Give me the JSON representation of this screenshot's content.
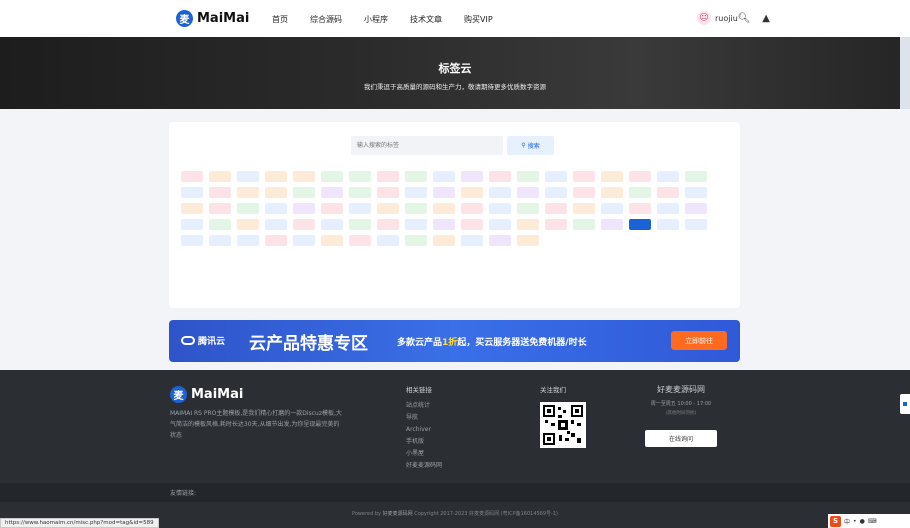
{
  "header": {
    "logo_mark": "麦",
    "logo_text": "MaiMai",
    "nav": [
      "首页",
      "综合源码",
      "小程序",
      "技术文章",
      "购买VIP"
    ],
    "user_name": "ruojiu"
  },
  "hero": {
    "title": "标签云",
    "subtitle": "我们秉逗于高质量的源码和生产力，敬请期待更多优质数字资源"
  },
  "search": {
    "placeholder": "输入搜索的标签",
    "button_label": "搜索"
  },
  "tags": [
    {
      "label": "",
      "bg": "#fde2e7",
      "fg": "#e8467c"
    },
    {
      "label": "",
      "bg": "#fdebd7",
      "fg": "#ef8a1f"
    },
    {
      "label": "",
      "bg": "#e5efff",
      "fg": "#2e6fe0"
    },
    {
      "label": "",
      "bg": "#fdebd7",
      "fg": "#ef8a1f"
    },
    {
      "label": "",
      "bg": "#fdebd7",
      "fg": "#ef8a1f"
    },
    {
      "label": "",
      "bg": "#e3f6e6",
      "fg": "#2fa84b"
    },
    {
      "label": "",
      "bg": "#e3f6e6",
      "fg": "#2fa84b"
    },
    {
      "label": "",
      "bg": "#fde2e7",
      "fg": "#e8467c"
    },
    {
      "label": "",
      "bg": "#e3f6e6",
      "fg": "#2fa84b"
    },
    {
      "label": "",
      "bg": "#e5efff",
      "fg": "#2e6fe0"
    },
    {
      "label": "",
      "bg": "#efe5fd",
      "fg": "#8a4fe0"
    },
    {
      "label": "",
      "bg": "#fde2e7",
      "fg": "#e8467c"
    },
    {
      "label": "",
      "bg": "#e3f6e6",
      "fg": "#2fa84b"
    },
    {
      "label": "",
      "bg": "#e5efff",
      "fg": "#2e6fe0"
    },
    {
      "label": "",
      "bg": "#fde2e7",
      "fg": "#e8467c"
    },
    {
      "label": "",
      "bg": "#fdebd7",
      "fg": "#ef8a1f"
    },
    {
      "label": "",
      "bg": "#fde2e7",
      "fg": "#e8467c"
    },
    {
      "label": "",
      "bg": "#e5efff",
      "fg": "#2e6fe0"
    },
    {
      "label": "",
      "bg": "#e3f6e6",
      "fg": "#2fa84b"
    },
    {
      "label": "",
      "bg": "#e5efff",
      "fg": "#2e6fe0"
    },
    {
      "label": "",
      "bg": "#fde2e7",
      "fg": "#e8467c"
    },
    {
      "label": "",
      "bg": "#fdebd7",
      "fg": "#ef8a1f"
    },
    {
      "label": "",
      "bg": "#fdebd7",
      "fg": "#ef8a1f"
    },
    {
      "label": "",
      "bg": "#e3f6e6",
      "fg": "#2fa84b"
    },
    {
      "label": "",
      "bg": "#efe5fd",
      "fg": "#8a4fe0"
    },
    {
      "label": "",
      "bg": "#e3f6e6",
      "fg": "#2fa84b"
    },
    {
      "label": "",
      "bg": "#fde2e7",
      "fg": "#e8467c"
    },
    {
      "label": "",
      "bg": "#e5efff",
      "fg": "#2e6fe0"
    },
    {
      "label": "",
      "bg": "#efe5fd",
      "fg": "#8a4fe0"
    },
    {
      "label": "",
      "bg": "#fdebd7",
      "fg": "#ef8a1f"
    },
    {
      "label": "",
      "bg": "#e5efff",
      "fg": "#2e6fe0"
    },
    {
      "label": "",
      "bg": "#efe5fd",
      "fg": "#8a4fe0"
    },
    {
      "label": "",
      "bg": "#e5efff",
      "fg": "#2e6fe0"
    },
    {
      "label": "",
      "bg": "#fde2e7",
      "fg": "#e8467c"
    },
    {
      "label": "",
      "bg": "#fdebd7",
      "fg": "#ef8a1f"
    },
    {
      "label": "",
      "bg": "#e3f6e6",
      "fg": "#2fa84b"
    },
    {
      "label": "",
      "bg": "#fde2e7",
      "fg": "#e8467c"
    },
    {
      "label": "",
      "bg": "#e5efff",
      "fg": "#2e6fe0"
    },
    {
      "label": "",
      "bg": "#fdebd7",
      "fg": "#ef8a1f"
    },
    {
      "label": "",
      "bg": "#fde2e7",
      "fg": "#e8467c"
    },
    {
      "label": "",
      "bg": "#e3f6e6",
      "fg": "#2fa84b"
    },
    {
      "label": "",
      "bg": "#e5efff",
      "fg": "#2e6fe0"
    },
    {
      "label": "",
      "bg": "#efe5fd",
      "fg": "#8a4fe0"
    },
    {
      "label": "",
      "bg": "#fde2e7",
      "fg": "#e8467c"
    },
    {
      "label": "",
      "bg": "#e5efff",
      "fg": "#2e6fe0"
    },
    {
      "label": "",
      "bg": "#fdebd7",
      "fg": "#ef8a1f"
    },
    {
      "label": "",
      "bg": "#e3f6e6",
      "fg": "#2fa84b"
    },
    {
      "label": "",
      "bg": "#fdebd7",
      "fg": "#ef8a1f"
    },
    {
      "label": "",
      "bg": "#fde2e7",
      "fg": "#e8467c"
    },
    {
      "label": "",
      "bg": "#e5efff",
      "fg": "#2e6fe0"
    },
    {
      "label": "",
      "bg": "#e3f6e6",
      "fg": "#2fa84b"
    },
    {
      "label": "",
      "bg": "#fde2e7",
      "fg": "#e8467c"
    },
    {
      "label": "",
      "bg": "#fdebd7",
      "fg": "#ef8a1f"
    },
    {
      "label": "",
      "bg": "#e5efff",
      "fg": "#2e6fe0"
    },
    {
      "label": "",
      "bg": "#fde2e7",
      "fg": "#e8467c"
    },
    {
      "label": "",
      "bg": "#e5efff",
      "fg": "#2e6fe0"
    },
    {
      "label": "",
      "bg": "#efe5fd",
      "fg": "#8a4fe0"
    },
    {
      "label": "",
      "bg": "#e5efff",
      "fg": "#2e6fe0"
    },
    {
      "label": "",
      "bg": "#e3f6e6",
      "fg": "#2fa84b"
    },
    {
      "label": "",
      "bg": "#fdebd7",
      "fg": "#ef8a1f"
    },
    {
      "label": "",
      "bg": "#e5efff",
      "fg": "#2e6fe0"
    },
    {
      "label": "",
      "bg": "#fde2e7",
      "fg": "#e8467c"
    },
    {
      "label": "",
      "bg": "#e5efff",
      "fg": "#2e6fe0"
    },
    {
      "label": "",
      "bg": "#e3f6e6",
      "fg": "#2fa84b"
    },
    {
      "label": "",
      "bg": "#fde2e7",
      "fg": "#e8467c"
    },
    {
      "label": "",
      "bg": "#e5efff",
      "fg": "#2e6fe0"
    },
    {
      "label": "",
      "bg": "#efe5fd",
      "fg": "#8a4fe0"
    },
    {
      "label": "",
      "bg": "#fde2e7",
      "fg": "#e8467c"
    },
    {
      "label": "",
      "bg": "#e5efff",
      "fg": "#2e6fe0"
    },
    {
      "label": "",
      "bg": "#fdebd7",
      "fg": "#ef8a1f"
    },
    {
      "label": "",
      "bg": "#fde2e7",
      "fg": "#e8467c"
    },
    {
      "label": "",
      "bg": "#e3f6e6",
      "fg": "#2fa84b"
    },
    {
      "label": "",
      "bg": "#efe5fd",
      "fg": "#8a4fe0"
    },
    {
      "label": "",
      "bg": "#1a62d6",
      "fg": "#ffffff"
    },
    {
      "label": "",
      "bg": "#e5efff",
      "fg": "#2e6fe0"
    },
    {
      "label": "",
      "bg": "#e5efff",
      "fg": "#2e6fe0"
    },
    {
      "label": "",
      "bg": "#e5efff",
      "fg": "#2e6fe0"
    },
    {
      "label": "",
      "bg": "#e5efff",
      "fg": "#2e6fe0"
    },
    {
      "label": "",
      "bg": "#e5efff",
      "fg": "#2e6fe0"
    },
    {
      "label": "",
      "bg": "#fde2e7",
      "fg": "#e8467c"
    },
    {
      "label": "",
      "bg": "#e5efff",
      "fg": "#2e6fe0"
    },
    {
      "label": "",
      "bg": "#fdebd7",
      "fg": "#ef8a1f"
    },
    {
      "label": "",
      "bg": "#fde2e7",
      "fg": "#e8467c"
    },
    {
      "label": "",
      "bg": "#e5efff",
      "fg": "#2e6fe0"
    },
    {
      "label": "",
      "bg": "#e3f6e6",
      "fg": "#2fa84b"
    },
    {
      "label": "",
      "bg": "#fdebd7",
      "fg": "#ef8a1f"
    },
    {
      "label": "",
      "bg": "#e5efff",
      "fg": "#2e6fe0"
    },
    {
      "label": "",
      "bg": "#efe5fd",
      "fg": "#8a4fe0"
    },
    {
      "label": "",
      "bg": "#fdebd7",
      "fg": "#ef8a1f"
    }
  ],
  "banner": {
    "brand": "腾讯云",
    "headline": "云产品特惠专区",
    "sub_before": "多款云产品",
    "sub_highlight": "1折",
    "sub_after": "起，买云服务器送免费机器/时长",
    "cta": "立即前往"
  },
  "footer": {
    "logo_mark": "麦",
    "logo_text": "MaiMai",
    "description": "MAIMAI RS PRO主题模板,是我们精心打磨的一款Discuz模板,大气简洁的模板风格,耗时长达30天,从细节出发,为你呈现最完美的状态",
    "links_heading": "相关链接",
    "links": [
      "站点统计",
      "导航",
      "Archiver",
      "手机版",
      "小黑屋",
      "好麦麦源码网"
    ],
    "follow_heading": "关注我们",
    "site_name": "好麦麦源码网",
    "hours": "周一至周五 10:00 - 17:00",
    "hours_note": "(其他时间勿扰)",
    "consult_label": "在线询问",
    "friend_links": "友情链接:",
    "copyright_pre": "Powered by",
    "copyright_brand": "好麦麦源码网",
    "copyright_post": "Copyright 2017-2023 好麦麦源码网 (粤ICP备16014569号-1)"
  },
  "status_url": "https://www.haomaim.cn/misc.php?mod=tag&id=589",
  "colors": {
    "accent": "#1a62d6",
    "footer_bg": "#2b2f33"
  }
}
